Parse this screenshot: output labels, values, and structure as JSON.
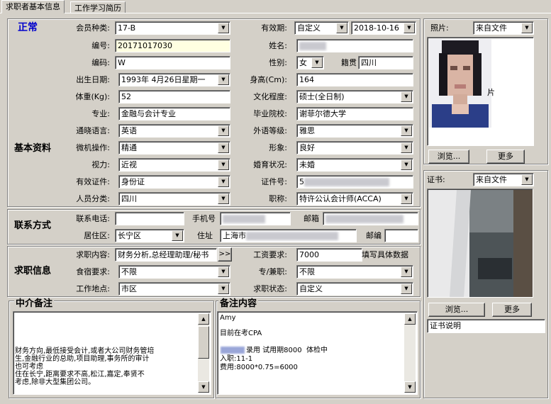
{
  "tabs": [
    "求职者基本信息",
    "工作学习简历"
  ],
  "status": "正常",
  "member_type": {
    "label": "会员种类:",
    "value": "17-B"
  },
  "validity": {
    "label": "有效期:",
    "mode": "自定义",
    "date": "2018-10-16"
  },
  "photo": {
    "label": "照片:",
    "source": "来自文件",
    "caption": "片",
    "browse": "浏览...",
    "more": "更多"
  },
  "basic": {
    "section_title": "基本资料",
    "number": {
      "label": "编号:",
      "value": "20171017030"
    },
    "name": {
      "label": "姓名:",
      "value": ""
    },
    "code": {
      "label": "编码:",
      "value": "W"
    },
    "gender": {
      "label": "性别:",
      "value": "女"
    },
    "native": {
      "label": "籍贯",
      "value": "四川"
    },
    "birth": {
      "label": "出生日期:",
      "value": "1993年 4月26日星期一"
    },
    "height": {
      "label": "身高(Cm):",
      "value": "164"
    },
    "weight": {
      "label": "体重(Kg):",
      "value": "52"
    },
    "education": {
      "label": "文化程度:",
      "value": "硕士(全日制)"
    },
    "major": {
      "label": "专业:",
      "value": "金融与会计专业"
    },
    "school": {
      "label": "毕业院校:",
      "value": "谢菲尔德大学"
    },
    "language": {
      "label": "通晓语言:",
      "value": "英语"
    },
    "foreign_level": {
      "label": "外语等级:",
      "value": "雅思"
    },
    "computer": {
      "label": "微机操作:",
      "value": "精通"
    },
    "image": {
      "label": "形象:",
      "value": "良好"
    },
    "vision": {
      "label": "视力:",
      "value": "近视"
    },
    "marital": {
      "label": "婚育状况:",
      "value": "未婚"
    },
    "id_type": {
      "label": "有效证件:",
      "value": "身份证"
    },
    "id_no": {
      "label": "证件号:",
      "value": "5"
    },
    "category": {
      "label": "人员分类:",
      "value": "四川"
    },
    "title": {
      "label": "职称:",
      "value": "特许公认会计师(ACCA)"
    }
  },
  "contact": {
    "section_title": "联系方式",
    "phone": {
      "label": "联系电话:",
      "value": ""
    },
    "mobile": {
      "label": "手机号",
      "value": ""
    },
    "email": {
      "label": "邮箱",
      "value": ""
    },
    "district": {
      "label": "居住区:",
      "value": "长宁区"
    },
    "address": {
      "label": "住址",
      "value": "上海市"
    },
    "postcode": {
      "label": "邮编",
      "value": ""
    }
  },
  "jobinfo": {
    "section_title": "求职信息",
    "content": {
      "label": "求职内容:",
      "value": "财务分析,总经理助理/秘书",
      "more": ">>"
    },
    "salary": {
      "label": "工资要求:",
      "value": "7000",
      "hint": "填写具体数据"
    },
    "accommodation": {
      "label": "食宿要求:",
      "value": "不限"
    },
    "fulltime": {
      "label": "专/兼职:",
      "value": "不限"
    },
    "location": {
      "label": "工作地点:",
      "value": "市区"
    },
    "state": {
      "label": "求职状态:",
      "value": "自定义"
    }
  },
  "cert": {
    "label": "证书:",
    "source": "来自文件",
    "browse": "浏览...",
    "more": "更多",
    "desc": "证书说明"
  },
  "agency_note": {
    "title": "中介备注",
    "lines": [
      "财务方向,最低接受会计,或者大公司财务管培",
      "生,金融行业的总助,项目助理,事务所的审计",
      "也可考虑",
      "住在长宁,距离要求不高,松江,嘉定,奉贤不",
      "考虑,除非大型集团公司。"
    ]
  },
  "remark": {
    "title": "备注内容",
    "l1": "Amy",
    "l2": "目前在考CPA",
    "l3a": "录用 试用期8000  体检中",
    "l4": "入职:11-1",
    "l5": "费用:8000*0.75=6000"
  },
  "colors": {
    "bg": "#d4d0c8",
    "status": "#0000cc",
    "field_yellow": "#ffffe1"
  }
}
